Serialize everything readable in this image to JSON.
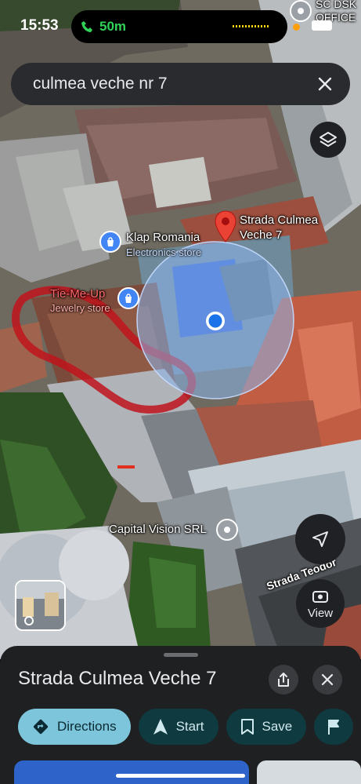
{
  "status": {
    "time": "15:53",
    "call_duration": "50m"
  },
  "search": {
    "query": "culmea veche nr 7"
  },
  "map": {
    "places": [
      {
        "id": "klap",
        "name": "Klap Romania",
        "category": "Electronics store"
      },
      {
        "id": "tie",
        "name": "Tie-Me-Up",
        "category": "Jewelry store"
      },
      {
        "id": "dest",
        "name": "Strada Culmea Veche 7"
      },
      {
        "id": "capital",
        "name": "Capital Vision SRL"
      },
      {
        "id": "sc",
        "name": "SC DSK OFFICE"
      }
    ],
    "street_label": "Strada Teodor",
    "view_label": "View"
  },
  "sheet": {
    "title": "Strada Culmea Veche 7",
    "actions": [
      {
        "id": "directions",
        "label": "Directions"
      },
      {
        "id": "start",
        "label": "Start"
      },
      {
        "id": "save",
        "label": "Save"
      }
    ]
  },
  "colors": {
    "location_blue": "#1a73e8",
    "pin_red": "#ea4335",
    "directions_chip": "#7cc5da",
    "secondary_chip": "#0f3a3f",
    "sheet_bg": "#1f2022",
    "search_bg": "#2a2b2e",
    "annotation_red": "#c0141c"
  },
  "icons": [
    "search-clear-icon",
    "layers-icon",
    "navigation-arrow-icon",
    "street-view-icon",
    "share-icon",
    "close-icon",
    "directions-icon",
    "start-arrow-icon",
    "bookmark-icon",
    "flag-icon",
    "shopping-bag-icon",
    "place-pin-icon",
    "phone-icon",
    "location-dot-icon"
  ]
}
